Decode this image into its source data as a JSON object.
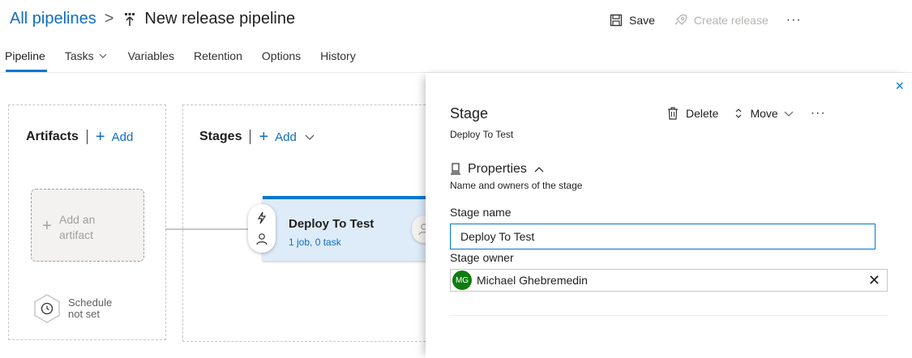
{
  "header": {
    "breadcrumb_root": "All pipelines",
    "separator": ">",
    "title": "New release pipeline",
    "save_label": "Save",
    "create_release_label": "Create release",
    "more_label": "···"
  },
  "tabs": [
    {
      "label": "Pipeline",
      "active": true
    },
    {
      "label": "Tasks",
      "has_dropdown": true
    },
    {
      "label": "Variables"
    },
    {
      "label": "Retention"
    },
    {
      "label": "Options"
    },
    {
      "label": "History"
    }
  ],
  "artifacts": {
    "title": "Artifacts",
    "add_label": "Add",
    "card_text_line1": "Add an",
    "card_text_line2": "artifact",
    "schedule_line1": "Schedule",
    "schedule_line2": "not set"
  },
  "stages": {
    "title": "Stages",
    "add_label": "Add",
    "card": {
      "name": "Deploy To Test",
      "jobs": "1 job, 0 task"
    }
  },
  "panel": {
    "close_label": "×",
    "title": "Stage",
    "subtitle": "Deploy To Test",
    "delete_label": "Delete",
    "move_label": "Move",
    "more_label": "···",
    "properties_title": "Properties",
    "properties_desc": "Name and owners of the stage",
    "stage_name_label": "Stage name",
    "stage_name_value": "Deploy To Test",
    "stage_owner_label": "Stage owner",
    "owner_initials": "MG",
    "owner_name": "Michael Ghebremedin",
    "owner_remove": "✕"
  },
  "colors": {
    "accent": "#0078d4",
    "link": "#106ebe",
    "stage_card_bg": "#deecf9",
    "avatar_bg": "#107c10"
  }
}
